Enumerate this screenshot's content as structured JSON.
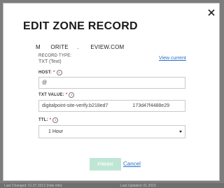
{
  "background": {
    "left_text": "Last Changed: 01.07.2013 (hide info)",
    "right_text": "Last Updated: 01.2023"
  },
  "modal": {
    "title": "EDIT ZONE RECORD",
    "domain": "M      ORITE     .       EVIEW.COM",
    "close_icon": "close-icon",
    "record_type": {
      "label": "RECORD TYPE:",
      "value": "TXT (Text)",
      "view_current": "View current"
    },
    "host": {
      "label": "HOST:",
      "required_mark": "*",
      "value": "@"
    },
    "txt_value": {
      "label": "TXT VALUE:",
      "required_mark": "*",
      "value": "digitalpoint-site-verify.b218ed7                  173d47f4488e29"
    },
    "ttl": {
      "label": "TTL:",
      "required_mark": "*",
      "selected": "1 Hour"
    },
    "actions": {
      "finish": "FINISH",
      "cancel": "Cancel"
    }
  },
  "colors": {
    "accent_button": "#bfe6d4",
    "link": "#2a6fc9",
    "required": "#d23a3a"
  }
}
